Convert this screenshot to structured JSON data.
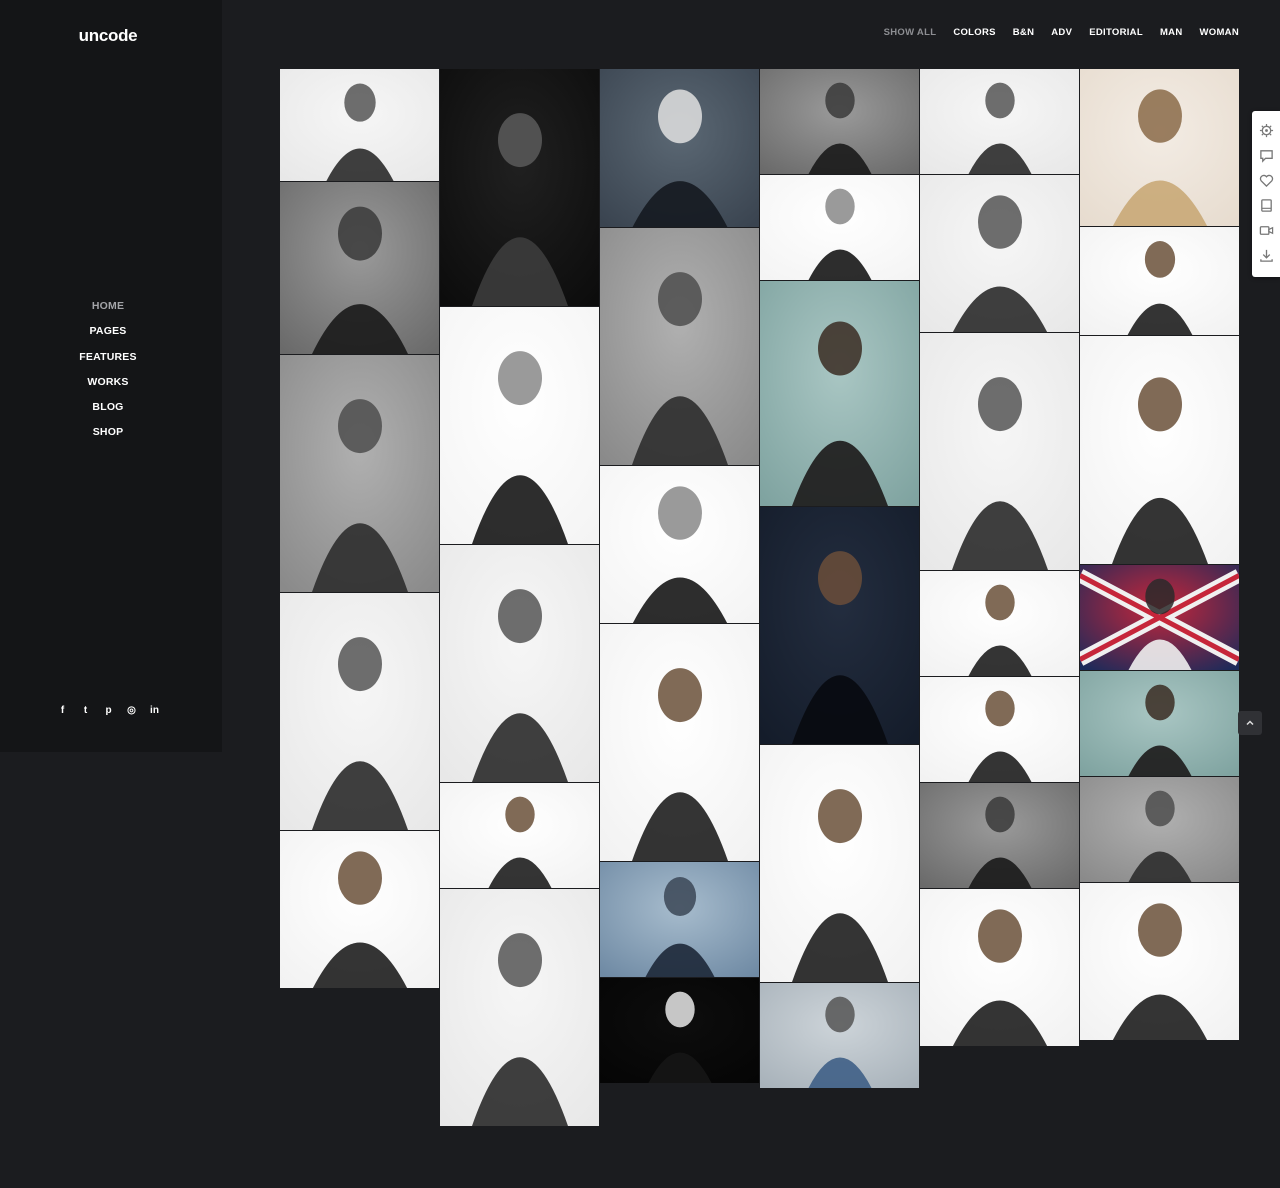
{
  "brand": {
    "logo": "uncode"
  },
  "menu": [
    {
      "label": "HOME",
      "active": true
    },
    {
      "label": "PAGES",
      "active": false
    },
    {
      "label": "FEATURES",
      "active": false
    },
    {
      "label": "WORKS",
      "active": false
    },
    {
      "label": "BLOG",
      "active": false
    },
    {
      "label": "SHOP",
      "active": false
    }
  ],
  "social": [
    {
      "icon": "facebook-icon",
      "glyph": "f"
    },
    {
      "icon": "twitter-icon",
      "glyph": "t"
    },
    {
      "icon": "pinterest-icon",
      "glyph": "p"
    },
    {
      "icon": "dribbble-icon",
      "glyph": "◎"
    },
    {
      "icon": "linkedin-icon",
      "glyph": "in"
    }
  ],
  "filters": [
    {
      "label": "SHOW ALL",
      "active": true
    },
    {
      "label": "COLORS",
      "active": false
    },
    {
      "label": "B&N",
      "active": false
    },
    {
      "label": "ADV",
      "active": false
    },
    {
      "label": "EDITORIAL",
      "active": false
    },
    {
      "label": "MAN",
      "active": false
    },
    {
      "label": "WOMAN",
      "active": false
    }
  ],
  "gallery": [
    [
      {
        "subject": "woman-profile-portrait",
        "palette": "light-bw"
      },
      {
        "subject": "bearded-man-profile",
        "palette": "mid-bw"
      },
      {
        "subject": "blonde-woman-striped-dress",
        "palette": "grey"
      },
      {
        "subject": "woman-black-turtleneck",
        "palette": "light-bw"
      },
      {
        "subject": "woman-love-tshirt",
        "palette": "white-color"
      }
    ],
    [
      {
        "subject": "man-black-hat",
        "palette": "dark-bw"
      },
      {
        "subject": "blonde-woman-leather-jacket",
        "palette": "white-bw"
      },
      {
        "subject": "woman-wide-brim-hat",
        "palette": "light-bw"
      },
      {
        "subject": "denim-shorts-detail",
        "palette": "white-color"
      },
      {
        "subject": "long-haired-man-open-jacket",
        "palette": "light-bw"
      }
    ],
    [
      {
        "subject": "woman-against-wall",
        "palette": "dark-cool"
      },
      {
        "subject": "man-grey-coat",
        "palette": "grey"
      },
      {
        "subject": "blonde-woman-sunglasses",
        "palette": "white-bw"
      },
      {
        "subject": "man-running-coat",
        "palette": "white-color"
      },
      {
        "subject": "woman-by-lake",
        "palette": "blue"
      },
      {
        "subject": "silhouette-profile",
        "palette": "black"
      }
    ],
    [
      {
        "subject": "two-men-posing",
        "palette": "mid-bw"
      },
      {
        "subject": "woman-denim-shirt",
        "palette": "white-bw"
      },
      {
        "subject": "bearded-man-sunglasses",
        "palette": "teal"
      },
      {
        "subject": "long-haired-man-dark",
        "palette": "navy"
      },
      {
        "subject": "man-yellow-shirt-walking",
        "palette": "white-color"
      },
      {
        "subject": "woman-blue-coat-street",
        "palette": "street"
      }
    ],
    [
      {
        "subject": "woman-hair-flying",
        "palette": "light-bw"
      },
      {
        "subject": "bearded-man-praying-hands",
        "palette": "light-bw"
      },
      {
        "subject": "man-glasses-suit",
        "palette": "light-bw"
      },
      {
        "subject": "couple-embracing",
        "palette": "white-color"
      },
      {
        "subject": "couple-portrait",
        "palette": "white-color"
      },
      {
        "subject": "couple-kissing-sunglasses",
        "palette": "mid-bw"
      },
      {
        "subject": "woman-beanie-camera",
        "palette": "white-color"
      }
    ],
    [
      {
        "subject": "blonde-woman-closeup",
        "palette": "warm"
      },
      {
        "subject": "man-beanie-wall",
        "palette": "white-color"
      },
      {
        "subject": "woman-drink-leather-jacket",
        "palette": "white-color"
      },
      {
        "subject": "woman-union-flag",
        "palette": "flag"
      },
      {
        "subject": "man-patterned-shirt",
        "palette": "teal"
      },
      {
        "subject": "man-tiled-wall",
        "palette": "grey"
      },
      {
        "subject": "woman-denim-jacket-skirt",
        "palette": "white-color"
      }
    ]
  ],
  "sidepanel": [
    "settings-icon",
    "comment-icon",
    "heart-icon",
    "book-icon",
    "video-icon",
    "download-icon"
  ],
  "colors": {
    "sidebar": "#141517",
    "background": "#1b1c1f",
    "accent": "#ffffff"
  }
}
